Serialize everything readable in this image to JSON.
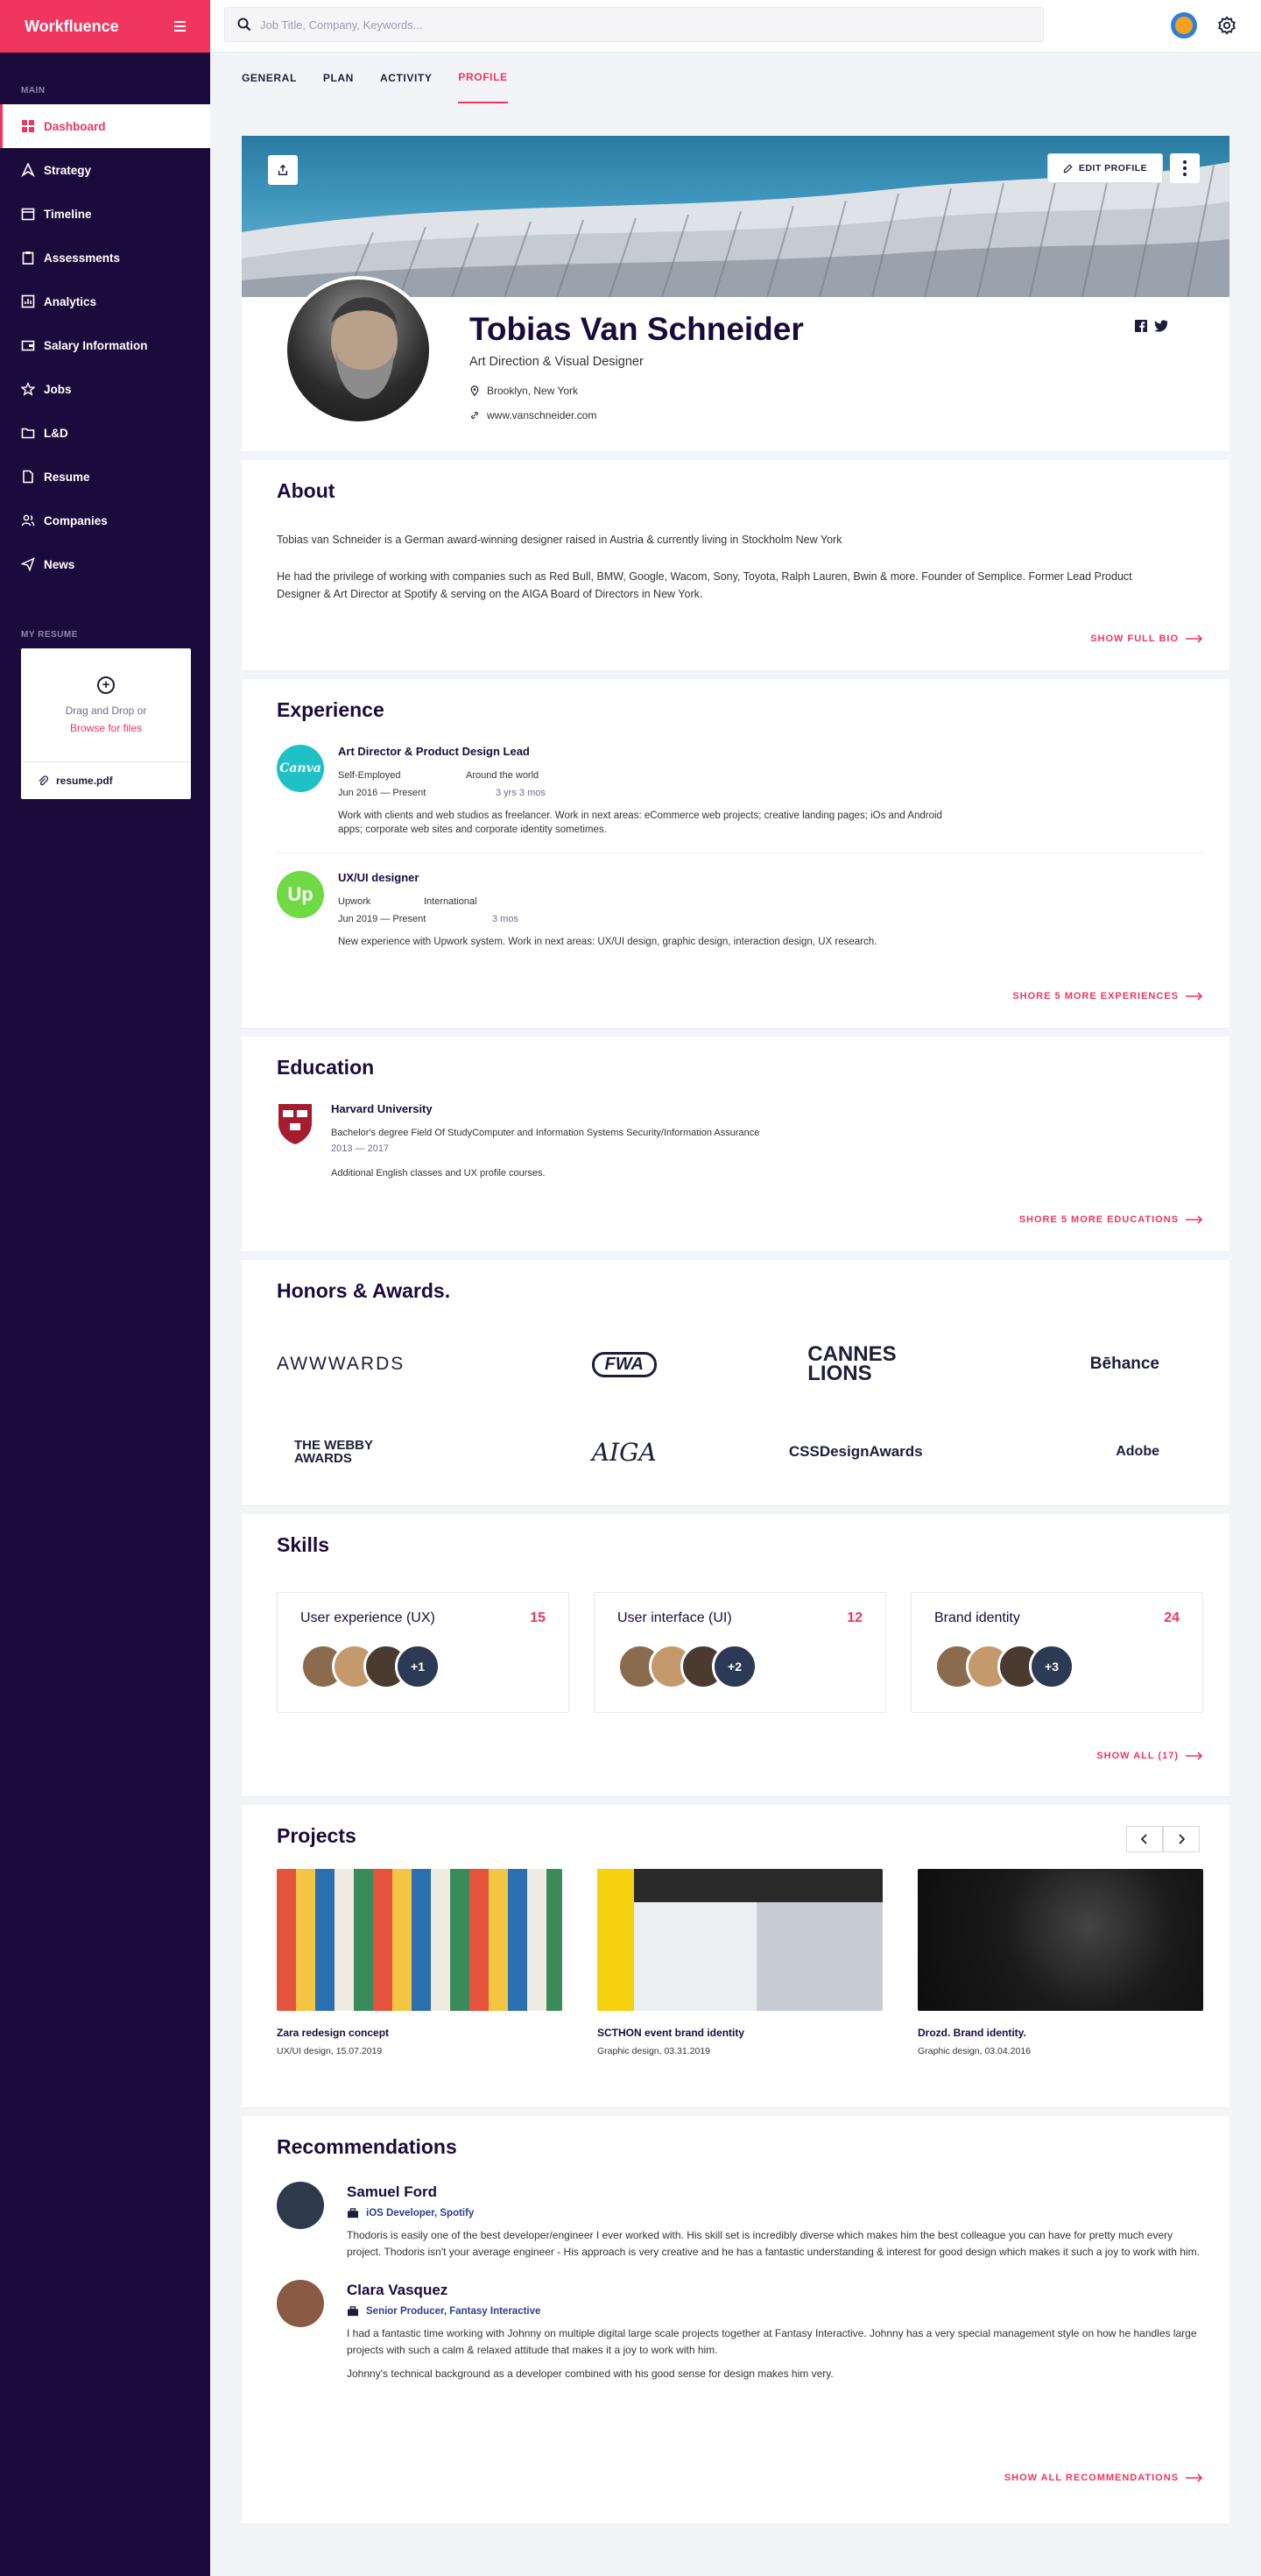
{
  "brand": {
    "name": "Workfluence"
  },
  "sidebar": {
    "section_main": "MAIN",
    "items": [
      {
        "label": "Dashboard",
        "icon": "grid-icon"
      },
      {
        "label": "Strategy",
        "icon": "compass-icon"
      },
      {
        "label": "Timeline",
        "icon": "calendar-icon"
      },
      {
        "label": "Assessments",
        "icon": "clipboard-icon"
      },
      {
        "label": "Analytics",
        "icon": "chart-icon"
      },
      {
        "label": "Salary Information",
        "icon": "wallet-icon"
      },
      {
        "label": "Jobs",
        "icon": "star-icon"
      },
      {
        "label": "L&D",
        "icon": "folder-icon"
      },
      {
        "label": "Resume",
        "icon": "document-icon"
      },
      {
        "label": "Companies",
        "icon": "users-icon"
      },
      {
        "label": "News",
        "icon": "send-icon"
      }
    ],
    "section_resume": "MY RESUME",
    "resume": {
      "drop_text": "Drag and Drop or",
      "browse": "Browse for files",
      "file": "resume.pdf"
    }
  },
  "search": {
    "placeholder": "Job Title, Company, Keywords..."
  },
  "tabs": [
    "GENERAL",
    "PLAN",
    "ACTIVITY",
    "PROFILE"
  ],
  "profile": {
    "edit_label": "EDIT PROFILE",
    "name": "Tobias Van Schneider",
    "role": "Art Direction & Visual Designer",
    "location": "Brooklyn, New York",
    "website": "www.vanschneider.com"
  },
  "about": {
    "title": "About",
    "p1": "Tobias van Schneider is a German award-winning designer raised in Austria & currently living in Stockholm New York",
    "p2": "He had the privilege of working with companies such as Red Bull, BMW, Google, Wacom, Sony, Toyota, Ralph Lauren, Bwin & more. Founder of Semplice. Former Lead Product Designer & Art Director at Spotify & serving on the AIGA Board of Directors in New York.",
    "link": "SHOW FULL BIO"
  },
  "experience": {
    "title": "Experience",
    "items": [
      {
        "logo": "Canva",
        "title": "Art Director & Product Design Lead",
        "company": "Self-Employed",
        "location": "Around the world",
        "dates": "Jun 2016 — Present",
        "duration": "3 yrs 3 mos",
        "desc": "Work with clients and web studios as freelancer.  Work in next areas: eCommerce web projects; creative landing pages; iOs and Android apps; corporate web sites and corporate identity sometimes."
      },
      {
        "logo": "Up",
        "title": "UX/UI designer",
        "company": "Upwork",
        "location": "International",
        "dates": "Jun 2019 — Present",
        "duration": "3 mos",
        "desc": "New experience with Upwork system. Work in next areas: UX/UI design, graphic design, interaction design, UX research."
      }
    ],
    "link": "SHORE 5 MORE EXPERIENCES"
  },
  "education": {
    "title": "Education",
    "school": "Harvard University",
    "degree": "Bachelor's degree Field Of StudyComputer and Information Systems Security/Information Assurance",
    "years": "2013 — 2017",
    "note": "Additional English classes and UX profile courses.",
    "link": "SHORE 5 MORE EDUCATIONS"
  },
  "awards": {
    "title": "Honors & Awards.",
    "logos": [
      "AWWWARDS",
      "FWA",
      "CANNES LIONS",
      "Bēhance",
      "THE WEBBY AWARDS",
      "AIGA",
      "CSSDesignAwards",
      "Adobe"
    ]
  },
  "skills": {
    "title": "Skills",
    "items": [
      {
        "name": "User experience (UX)",
        "count": "15",
        "more": "+1"
      },
      {
        "name": "User interface (UI)",
        "count": "12",
        "more": "+2"
      },
      {
        "name": "Brand identity",
        "count": "24",
        "more": "+3"
      }
    ],
    "link": "SHOW ALL (17)"
  },
  "projects": {
    "title": "Projects",
    "items": [
      {
        "title": "Zara redesign concept",
        "sub": "UX/UI design, 15.07.2019"
      },
      {
        "title": "SCTHON event brand identity",
        "sub": "Graphic design, 03.31.2019"
      },
      {
        "title": "Drozd. Brand identity.",
        "sub": "Graphic design, 03.04.2016"
      }
    ]
  },
  "recommendations": {
    "title": "Recommendations",
    "items": [
      {
        "name": "Samuel Ford",
        "role": "iOS Developer, Spotify",
        "text": [
          "Thodoris is easily one of the best developer/engineer I ever worked with. His skill set is incredibly diverse which makes him the best colleague you can have for pretty much every project. Thodoris isn't your average engineer - His approach is very creative and he has a fantastic understanding & interest for good design which makes it such a joy to work with him."
        ]
      },
      {
        "name": "Clara Vasquez",
        "role": "Senior Producer, Fantasy Interactive",
        "text": [
          "I had a fantastic time working with Johnny on multiple digital large scale projects together at Fantasy Interactive. Johnny has a very special management style on how he handles large projects with such a calm & relaxed attitude that makes it a joy to work with him.",
          "Johnny's technical background as a developer combined with his good sense for design makes him very."
        ]
      }
    ],
    "link": "SHOW ALL RECOMMENDATIONS"
  },
  "colors": {
    "accent": "#f0355e",
    "sidebar": "#1b0b3c"
  }
}
